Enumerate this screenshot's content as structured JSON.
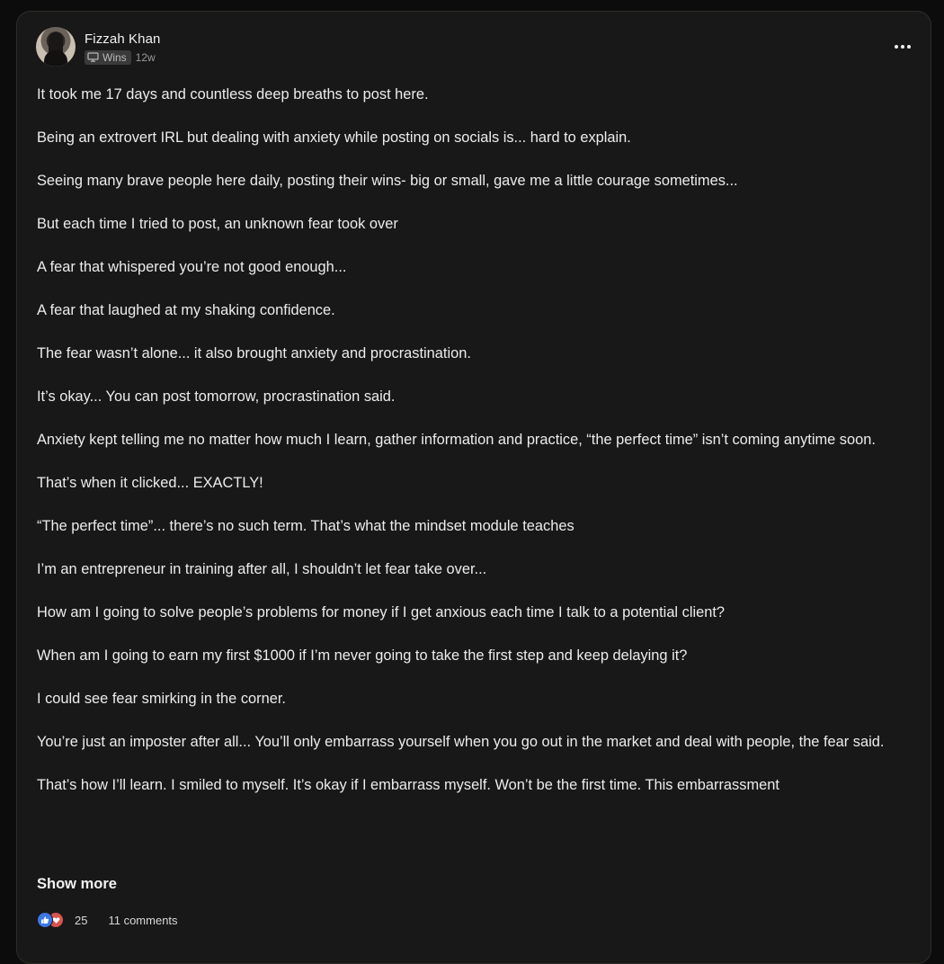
{
  "post": {
    "author": "Fizzah Khan",
    "category": "Wins",
    "time_ago": "12w",
    "paragraphs": [
      "It took me 17 days and countless deep breaths to post here.",
      "Being an extrovert IRL but dealing with anxiety while posting on socials is... hard to explain.",
      "Seeing many brave people here daily, posting their wins- big or small, gave me a little courage sometimes...",
      "But each time I tried to post, an unknown fear took over",
      "A fear that whispered you’re not good enough...",
      "A fear that laughed at my shaking confidence.",
      "The fear wasn’t alone... it also brought anxiety and procrastination.",
      "It’s okay... You can post tomorrow, procrastination said.",
      "Anxiety kept telling me no matter how much I learn, gather information and practice, “the perfect time” isn’t coming anytime soon.",
      "That’s when it clicked... EXACTLY!",
      "“The perfect time”... there’s no such term. That’s what the mindset module teaches",
      "I’m an entrepreneur in training after all, I shouldn’t let fear take over...",
      "How am I going to solve people’s problems for money if I get anxious each time I talk to a potential client?",
      "When am I going to earn my first $1000 if I’m never going to take the first step and keep delaying it?",
      "I could see fear smirking in the corner.",
      "You’re just an imposter after all... You’ll only embarrass yourself when you go out in the market and deal with people, the fear said.",
      "That’s how I’ll learn. I smiled to myself. It’s okay if I embarrass myself. Won’t be the first time. This embarrassment"
    ],
    "show_more_label": "Show more",
    "reaction_count": "25",
    "comments_label": "11 comments"
  },
  "icons": {
    "category": "monitor-icon",
    "menu": "more-horizontal-icon",
    "reaction_like": "thumbs-up-icon",
    "reaction_love": "heart-icon"
  },
  "colors": {
    "background": "#0c0c0c",
    "card": "#181818",
    "card_border": "#2e2d2a",
    "text": "#ececec",
    "muted": "#9a9a9a",
    "like": "#3b78e7",
    "love": "#d9534f"
  }
}
